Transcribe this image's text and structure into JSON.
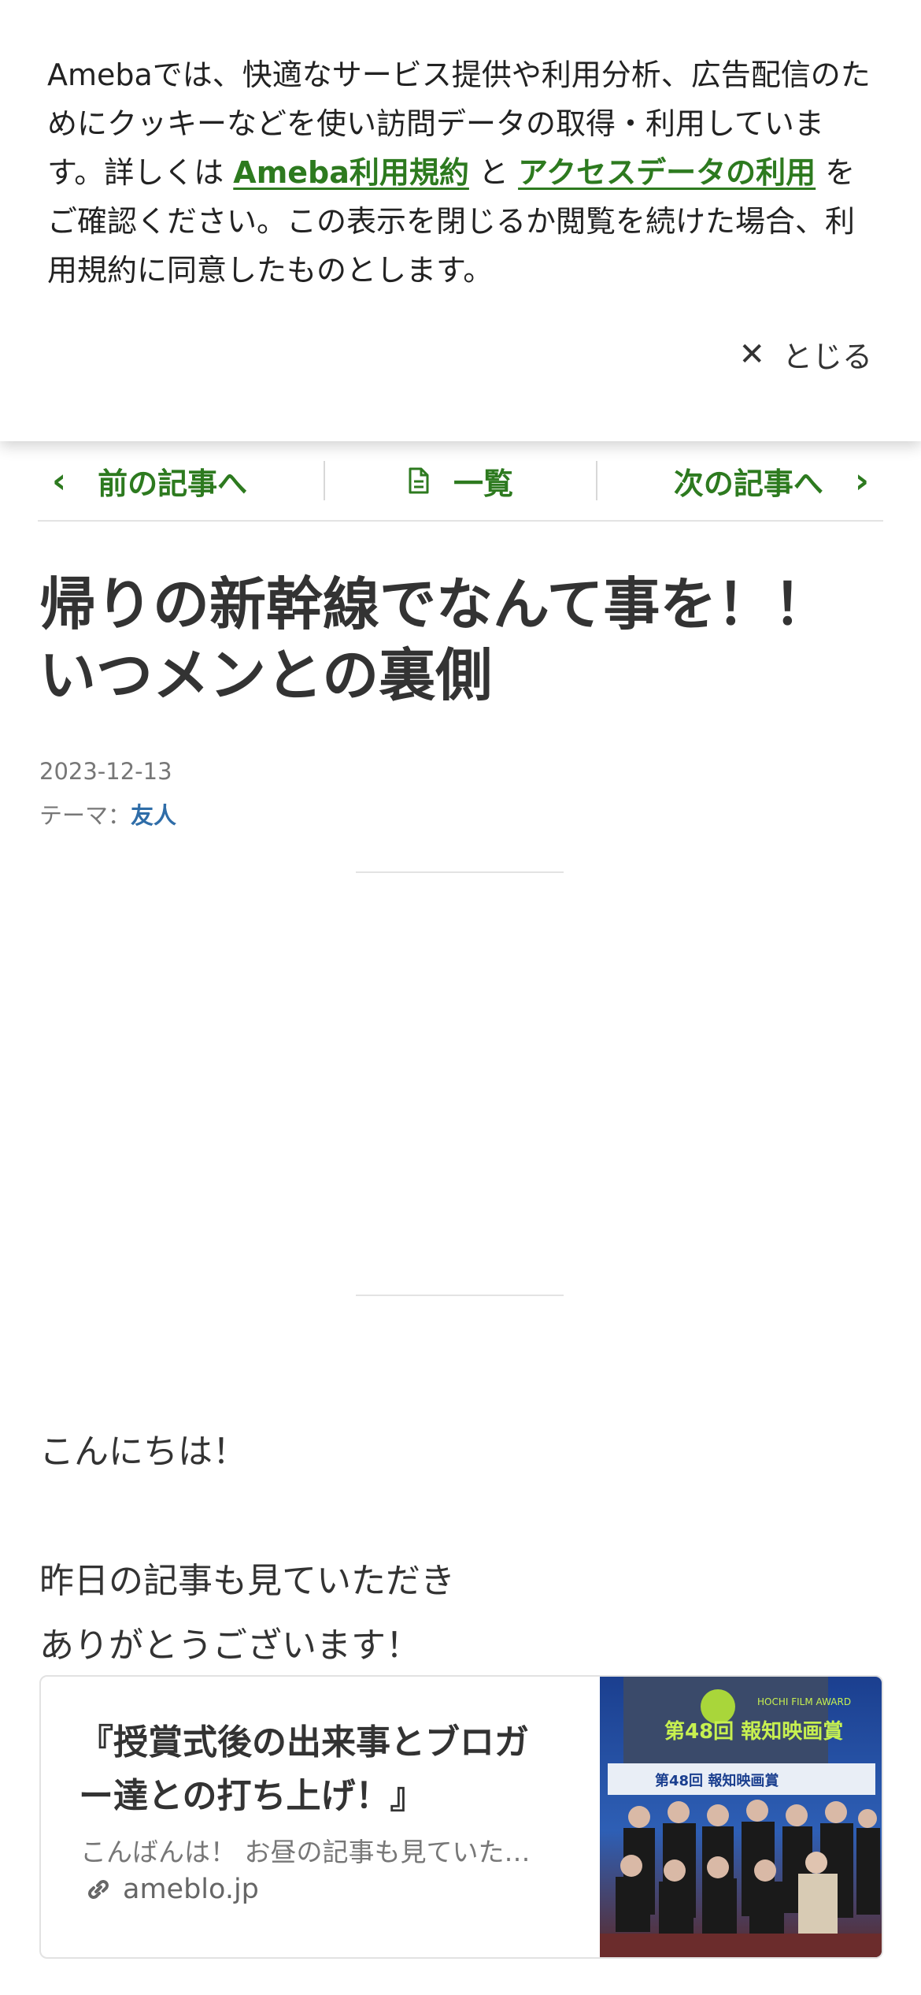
{
  "cookie_banner": {
    "text_before": "Amebaでは、快適なサービス提供や利用分析、広告配信のためにクッキーなどを使い訪問データの取得・利用しています。詳しくは ",
    "link_terms": "Ameba利用規約",
    "text_and": " と ",
    "link_access": "アクセスデータの利用",
    "text_after": " をご確認ください。この表示を閉じるか閲覧を続けた場合、利用規約に同意したものとします。",
    "close_label": "とじる"
  },
  "article_nav": {
    "prev": "前の記事へ",
    "list": "一覧",
    "next": "次の記事へ"
  },
  "article": {
    "title": "帰りの新幹線でなんて事を！！いつメンとの裏側",
    "date": "2023-12-13",
    "theme_label": "テーマ：",
    "theme_value": "友人",
    "body_greeting": "こんにちは！",
    "body_line1": "昨日の記事も見ていただき",
    "body_line2": "ありがとうございます！"
  },
  "link_card": {
    "title": "『授賞式後の出来事とブロガー達との打ち上げ！』",
    "description": "こんばんは！ お昼の記事も見ていただいた方",
    "domain": "ameblo.jp",
    "thumb_banner": "第48回 報知映画賞"
  },
  "colors": {
    "accent_green": "#2d7a1f",
    "theme_blue": "#2f6da8"
  }
}
